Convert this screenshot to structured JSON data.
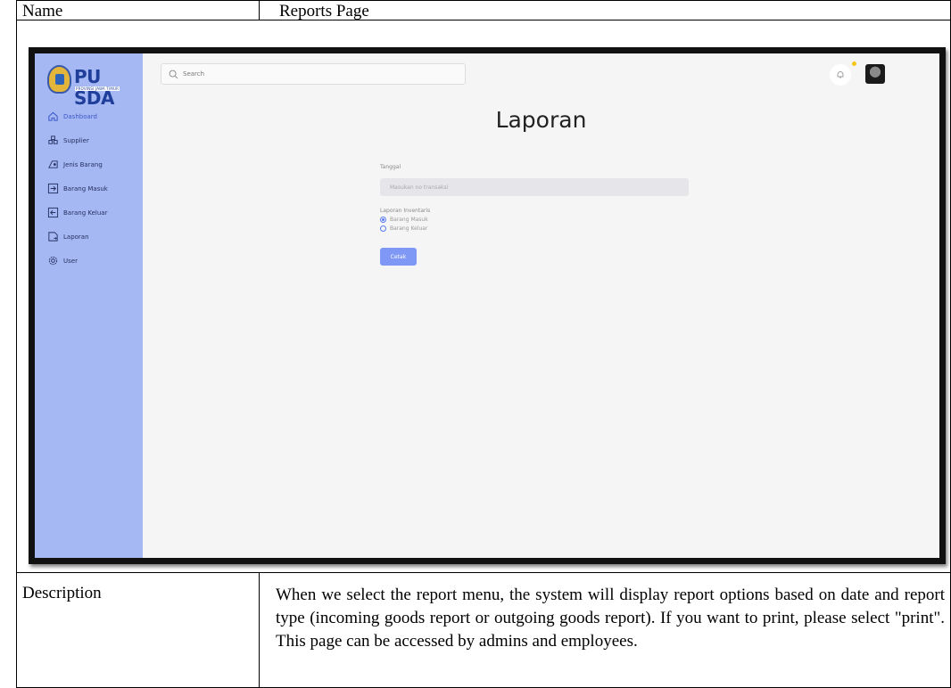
{
  "doc": {
    "name_label": "Name",
    "name_value": "Reports Page",
    "description_label": "Description",
    "description_text": "When we select the report menu, the system will display report options based on date and report type (incoming goods report or outgoing goods report). If you want to print, please select \"print\". This page can be accessed by admins and employees."
  },
  "app": {
    "logo": {
      "title": "PU SDA",
      "subtitle": "PROVINSI JAWA TIMUR"
    },
    "search": {
      "placeholder": "Search"
    },
    "sidebar": {
      "items": [
        {
          "label": "Dashboard",
          "icon": "home-icon",
          "active": true
        },
        {
          "label": "Supplier",
          "icon": "supplier-icon",
          "active": false
        },
        {
          "label": "Jenis Barang",
          "icon": "category-icon",
          "active": false
        },
        {
          "label": "Barang Masuk",
          "icon": "incoming-icon",
          "active": false
        },
        {
          "label": "Barang Keluar",
          "icon": "outgoing-icon",
          "active": false
        },
        {
          "label": "Laporan",
          "icon": "report-icon",
          "active": false
        },
        {
          "label": "User",
          "icon": "user-gear-icon",
          "active": false
        }
      ]
    },
    "page_title": "Laporan",
    "form": {
      "date_label": "Tanggal",
      "date_placeholder": "Masukan no transaksi",
      "report_label": "Laporan Inventaris",
      "options": [
        {
          "label": "Barang Masuk",
          "checked": true
        },
        {
          "label": "Barang Keluar",
          "checked": false
        }
      ],
      "print_button": "Cetak"
    },
    "colors": {
      "sidebar": "#a6b8f3",
      "accent": "#7f98f5",
      "active_nav": "#3b58c8",
      "notification_dot": "#f5c518"
    }
  }
}
